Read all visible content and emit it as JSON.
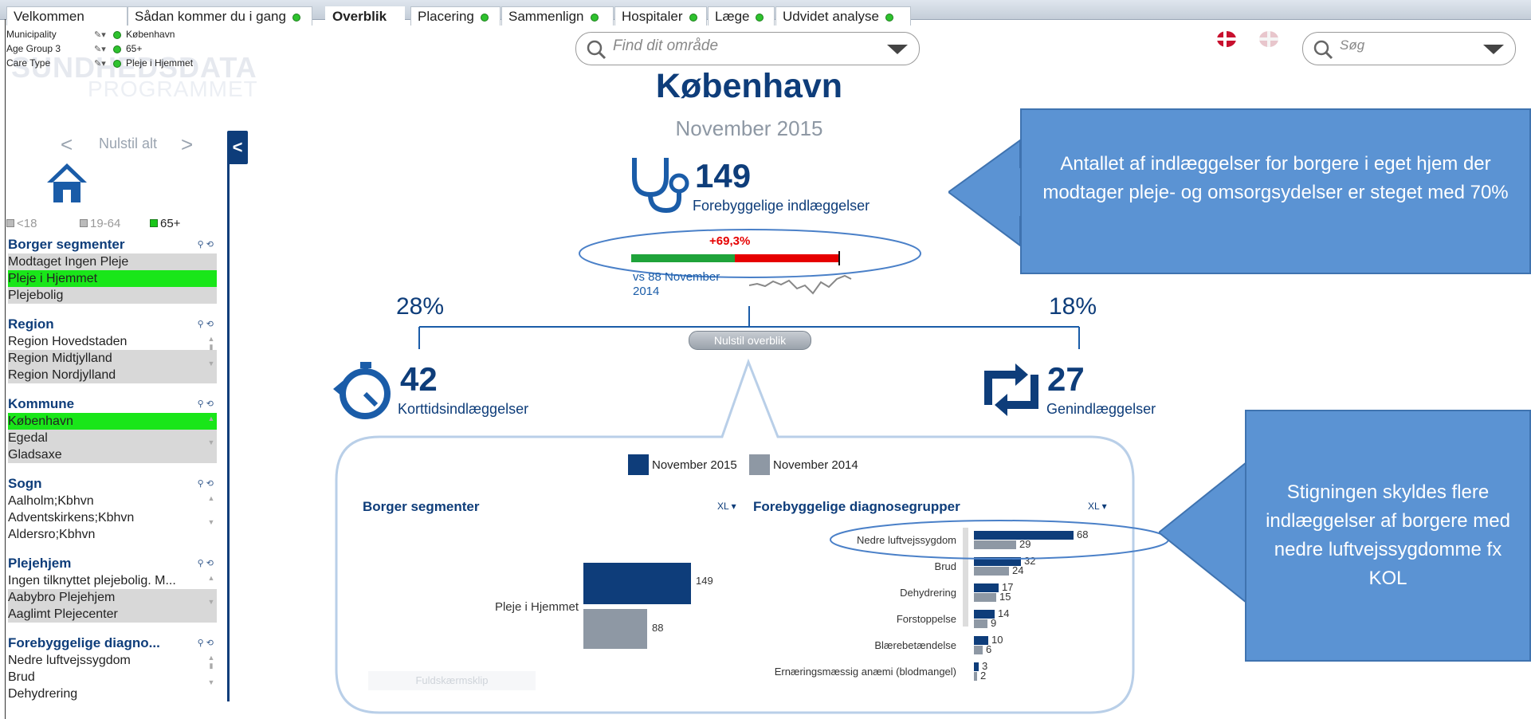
{
  "tabs": [
    {
      "label": "Velkommen",
      "dot": false
    },
    {
      "label": "Sådan kommer du i gang",
      "dot": true
    },
    {
      "label": "Overblik",
      "dot": false,
      "active": true
    },
    {
      "label": "Placering",
      "dot": true
    },
    {
      "label": "Sammenlign",
      "dot": true
    },
    {
      "label": "Hospitaler",
      "dot": true
    },
    {
      "label": "Læge",
      "dot": true
    },
    {
      "label": "Udvidet analyse",
      "dot": true
    }
  ],
  "selections": [
    {
      "field": "Municipality",
      "value": "København"
    },
    {
      "field": "Age Group 3",
      "value": "65+"
    },
    {
      "field": "Care Type",
      "value": "Pleje i Hjemmet"
    }
  ],
  "watermark": {
    "line1": "SUNDHEDSDATA",
    "line2": "PROGRAMMET"
  },
  "nav": {
    "prev": "<",
    "reset": "Nulstil alt",
    "next": ">"
  },
  "age_filters": [
    "<18",
    "19-64",
    "65+"
  ],
  "collapse_label": "<",
  "groups": [
    {
      "title": "Borger segmenter",
      "items": [
        {
          "text": "Modtaget Ingen Pleje",
          "state": "grey"
        },
        {
          "text": "Pleje i Hjemmet",
          "state": "green"
        },
        {
          "text": "Plejebolig",
          "state": "grey"
        }
      ]
    },
    {
      "title": "Region",
      "items": [
        {
          "text": "Region Hovedstaden",
          "state": "white"
        },
        {
          "text": "Region Midtjylland",
          "state": "grey"
        },
        {
          "text": "Region Nordjylland",
          "state": "grey"
        }
      ]
    },
    {
      "title": "Kommune",
      "items": [
        {
          "text": "København",
          "state": "green"
        },
        {
          "text": "Egedal",
          "state": "grey"
        },
        {
          "text": "Gladsaxe",
          "state": "grey"
        }
      ]
    },
    {
      "title": "Sogn",
      "items": [
        {
          "text": "Aalholm;Kbhvn",
          "state": "white"
        },
        {
          "text": "Adventskirkens;Kbhvn",
          "state": "white"
        },
        {
          "text": "Aldersro;Kbhvn",
          "state": "white"
        }
      ]
    },
    {
      "title": "Plejehjem",
      "items": [
        {
          "text": "Ingen tilknyttet plejebolig. M...",
          "state": "white"
        },
        {
          "text": "Aabybro Plejehjem",
          "state": "grey"
        },
        {
          "text": "Aaglimt Plejecenter",
          "state": "grey"
        }
      ]
    },
    {
      "title": "Forebyggelige diagno...",
      "items": [
        {
          "text": "Nedre luftvejssygdom",
          "state": "white"
        },
        {
          "text": "Brud",
          "state": "white"
        },
        {
          "text": "Dehydrering",
          "state": "white"
        }
      ]
    }
  ],
  "search_area": {
    "placeholder": "Find dit område"
  },
  "search_top": {
    "placeholder": "Søg"
  },
  "main": {
    "title": "København",
    "subtitle": "November 2015",
    "kpi_value": "149",
    "kpi_label": "Forebyggelige indlæggelser",
    "change": "+69,3%",
    "compare": "vs 88 November 2014",
    "left_pct": "28%",
    "right_pct": "18%",
    "reset_btn": "Nulstil overblik",
    "short_value": "42",
    "short_label": "Korttidsindlæggelser",
    "re_value": "27",
    "re_label": "Genindlæggelser",
    "fullscreen": "Fuldskærmsklip"
  },
  "callouts": {
    "top": "Antallet af indlæggelser for borgere i eget hjem der modtager pleje- og omsorgsydelser er steget med 70%",
    "bottom": "Stigningen skyldes flere indlæggelser af borgere med nedre luftvejssygdomme fx KOL"
  },
  "legend": [
    "November 2015",
    "November 2014"
  ],
  "colors": {
    "nov2015": "#0e3d7a",
    "nov2014": "#8e98a4",
    "accent_green": "#19e619",
    "callout": "#5b93d3"
  },
  "chart_data": [
    {
      "type": "bar",
      "title": "Borger segmenter",
      "export_label": "XL",
      "categories": [
        "Pleje i Hjemmet"
      ],
      "series": [
        {
          "name": "November 2015",
          "values": [
            149
          ]
        },
        {
          "name": "November 2014",
          "values": [
            88
          ]
        }
      ]
    },
    {
      "type": "bar",
      "title": "Forebyggelige diagnosegrupper",
      "export_label": "XL",
      "categories": [
        "Nedre luftvejssygdom",
        "Brud",
        "Dehydrering",
        "Forstoppelse",
        "Blærebetændelse",
        "Ernæringsmæssig anæmi (blodmangel)"
      ],
      "series": [
        {
          "name": "November 2015",
          "values": [
            68,
            32,
            17,
            14,
            10,
            3
          ]
        },
        {
          "name": "November 2014",
          "values": [
            29,
            24,
            15,
            9,
            6,
            2
          ]
        }
      ]
    }
  ]
}
